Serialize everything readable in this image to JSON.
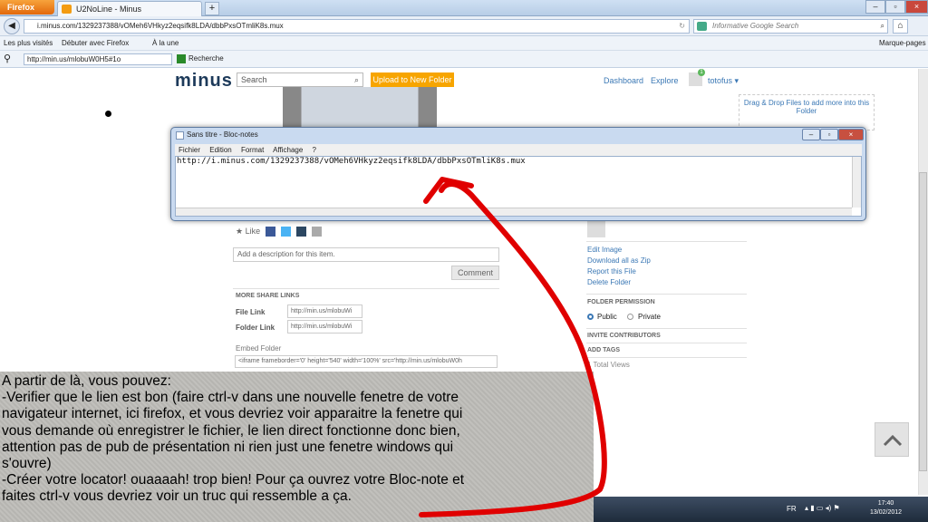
{
  "browser": {
    "app_button": "Firefox",
    "tab_title": "U2NoLine - Minus",
    "new_tab": "+",
    "url": "i.minus.com/1329237388/vOMeh6VHkyz2eqsifk8LDA/dbbPxsOTmliK8s.mux",
    "search_placeholder": "Informative Google Search",
    "bookmarks": [
      "Les plus visités",
      "Débuter avec Firefox",
      "À la une"
    ],
    "bookmarks_right": "Marque-pages",
    "addon_url": "http://min.us/mlobuW0H5#1o",
    "addon_search": "Recherche"
  },
  "minus": {
    "logo": "minus",
    "search_placeholder": "Search",
    "upload_label": "Upload to New Folder",
    "nav": [
      "Dashboard",
      "Explore"
    ],
    "user": "totofus",
    "badge_count": "1",
    "dropzone": "Drag & Drop Files to add more into this Folder",
    "like_label": "Like",
    "description_placeholder": "Add a description for this item.",
    "comment_button": "Comment",
    "share_header": "MORE SHARE LINKS",
    "file_link_label": "File Link",
    "file_link_value": "http://min.us/mlobuWi",
    "folder_link_label": "Folder Link",
    "folder_link_value": "http://min.us/mlobuWi",
    "embed_label": "Embed Folder",
    "embed_value": "<iframe frameborder='0' height='540' width='100%' src='http://min.us/mlobuW0h",
    "side_links": [
      "Edit Image",
      "Download all as Zip",
      "Report this File",
      "Delete Folder"
    ],
    "folder_permission": "FOLDER PERMISSION",
    "perm_public": "Public",
    "perm_private": "Private",
    "invite": "INVITE CONTRIBUTORS",
    "tags": "ADD TAGS",
    "views": "1 Total Views"
  },
  "notepad": {
    "title": "Sans titre - Bloc-notes",
    "menu": [
      "Fichier",
      "Edition",
      "Format",
      "Affichage",
      "?"
    ],
    "content": "http://i.minus.com/1329237388/vOMeh6VHkyz2eqsifk8LDA/dbbPxsOTmliK8s.mux"
  },
  "annotation": {
    "lines": [
      "A partir de là, vous pouvez:",
      "-Verifier que le lien est bon (faire ctrl-v dans une nouvelle fenetre de votre",
      "navigateur internet, ici firefox, et vous devriez voir apparaitre la fenetre qui",
      "vous demande où enregistrer le fichier, le lien direct fonctionne donc bien,",
      "attention pas de pub de présentation ni rien just une fenetre windows qui",
      "s'ouvre)",
      "-Créer votre locator! ouaaaah! trop bien! Pour ça ouvrez votre Bloc-note et",
      "faites ctrl-v vous devriez voir un truc qui ressemble a ça."
    ]
  },
  "taskbar": {
    "lang": "FR",
    "time": "17:40",
    "date": "13/02/2012"
  },
  "colors": {
    "arrow": "#e00000",
    "accent_orange": "#f7a500",
    "link_blue": "#3b78b5"
  }
}
